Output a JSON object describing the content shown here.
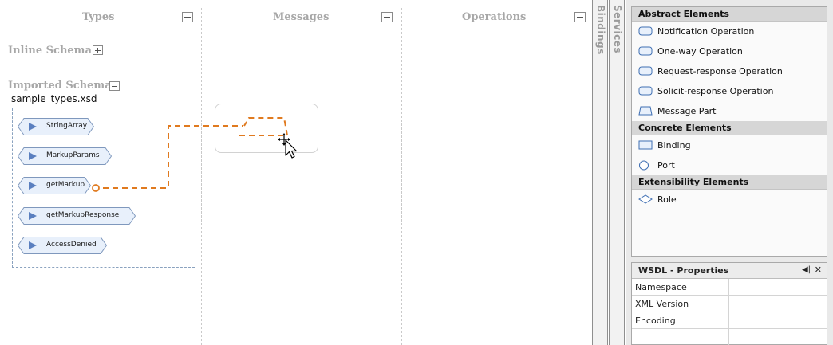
{
  "columns": {
    "types": "Types",
    "messages": "Messages",
    "operations": "Operations"
  },
  "schema": {
    "inline_label": "Inline Schema",
    "imported_label": "Imported Schema",
    "file": "sample_types.xsd",
    "types": [
      "StringArray",
      "MarkupParams",
      "getMarkup",
      "getMarkupResponse",
      "AccessDenied"
    ]
  },
  "side_tabs": {
    "bindings": "Bindings",
    "services": "Services"
  },
  "palette": {
    "categories": [
      {
        "title": "Abstract Elements",
        "items": [
          {
            "label": "Notification Operation",
            "icon": "rounded-rect-icon"
          },
          {
            "label": "One-way Operation",
            "icon": "rounded-rect-icon"
          },
          {
            "label": "Request-response Operation",
            "icon": "rounded-rect-icon"
          },
          {
            "label": "Solicit-response Operation",
            "icon": "rounded-rect-icon"
          },
          {
            "label": "Message Part",
            "icon": "trapezoid-icon"
          }
        ]
      },
      {
        "title": "Concrete Elements",
        "items": [
          {
            "label": "Binding",
            "icon": "rect-icon"
          },
          {
            "label": "Port",
            "icon": "circle-icon"
          }
        ]
      },
      {
        "title": "Extensibility Elements",
        "items": [
          {
            "label": "Role",
            "icon": "diamond-icon"
          }
        ]
      }
    ]
  },
  "properties": {
    "title": "WSDL - Properties",
    "pin_icon": "pin-icon",
    "close_icon": "close-icon",
    "rows": [
      "Namespace",
      "XML Version",
      "Encoding",
      ""
    ]
  },
  "colors": {
    "connector": "#e07a1f",
    "node_fill": "#e8f0fb",
    "node_border": "#7f98bd",
    "node_arrow": "#5a7fbf"
  }
}
